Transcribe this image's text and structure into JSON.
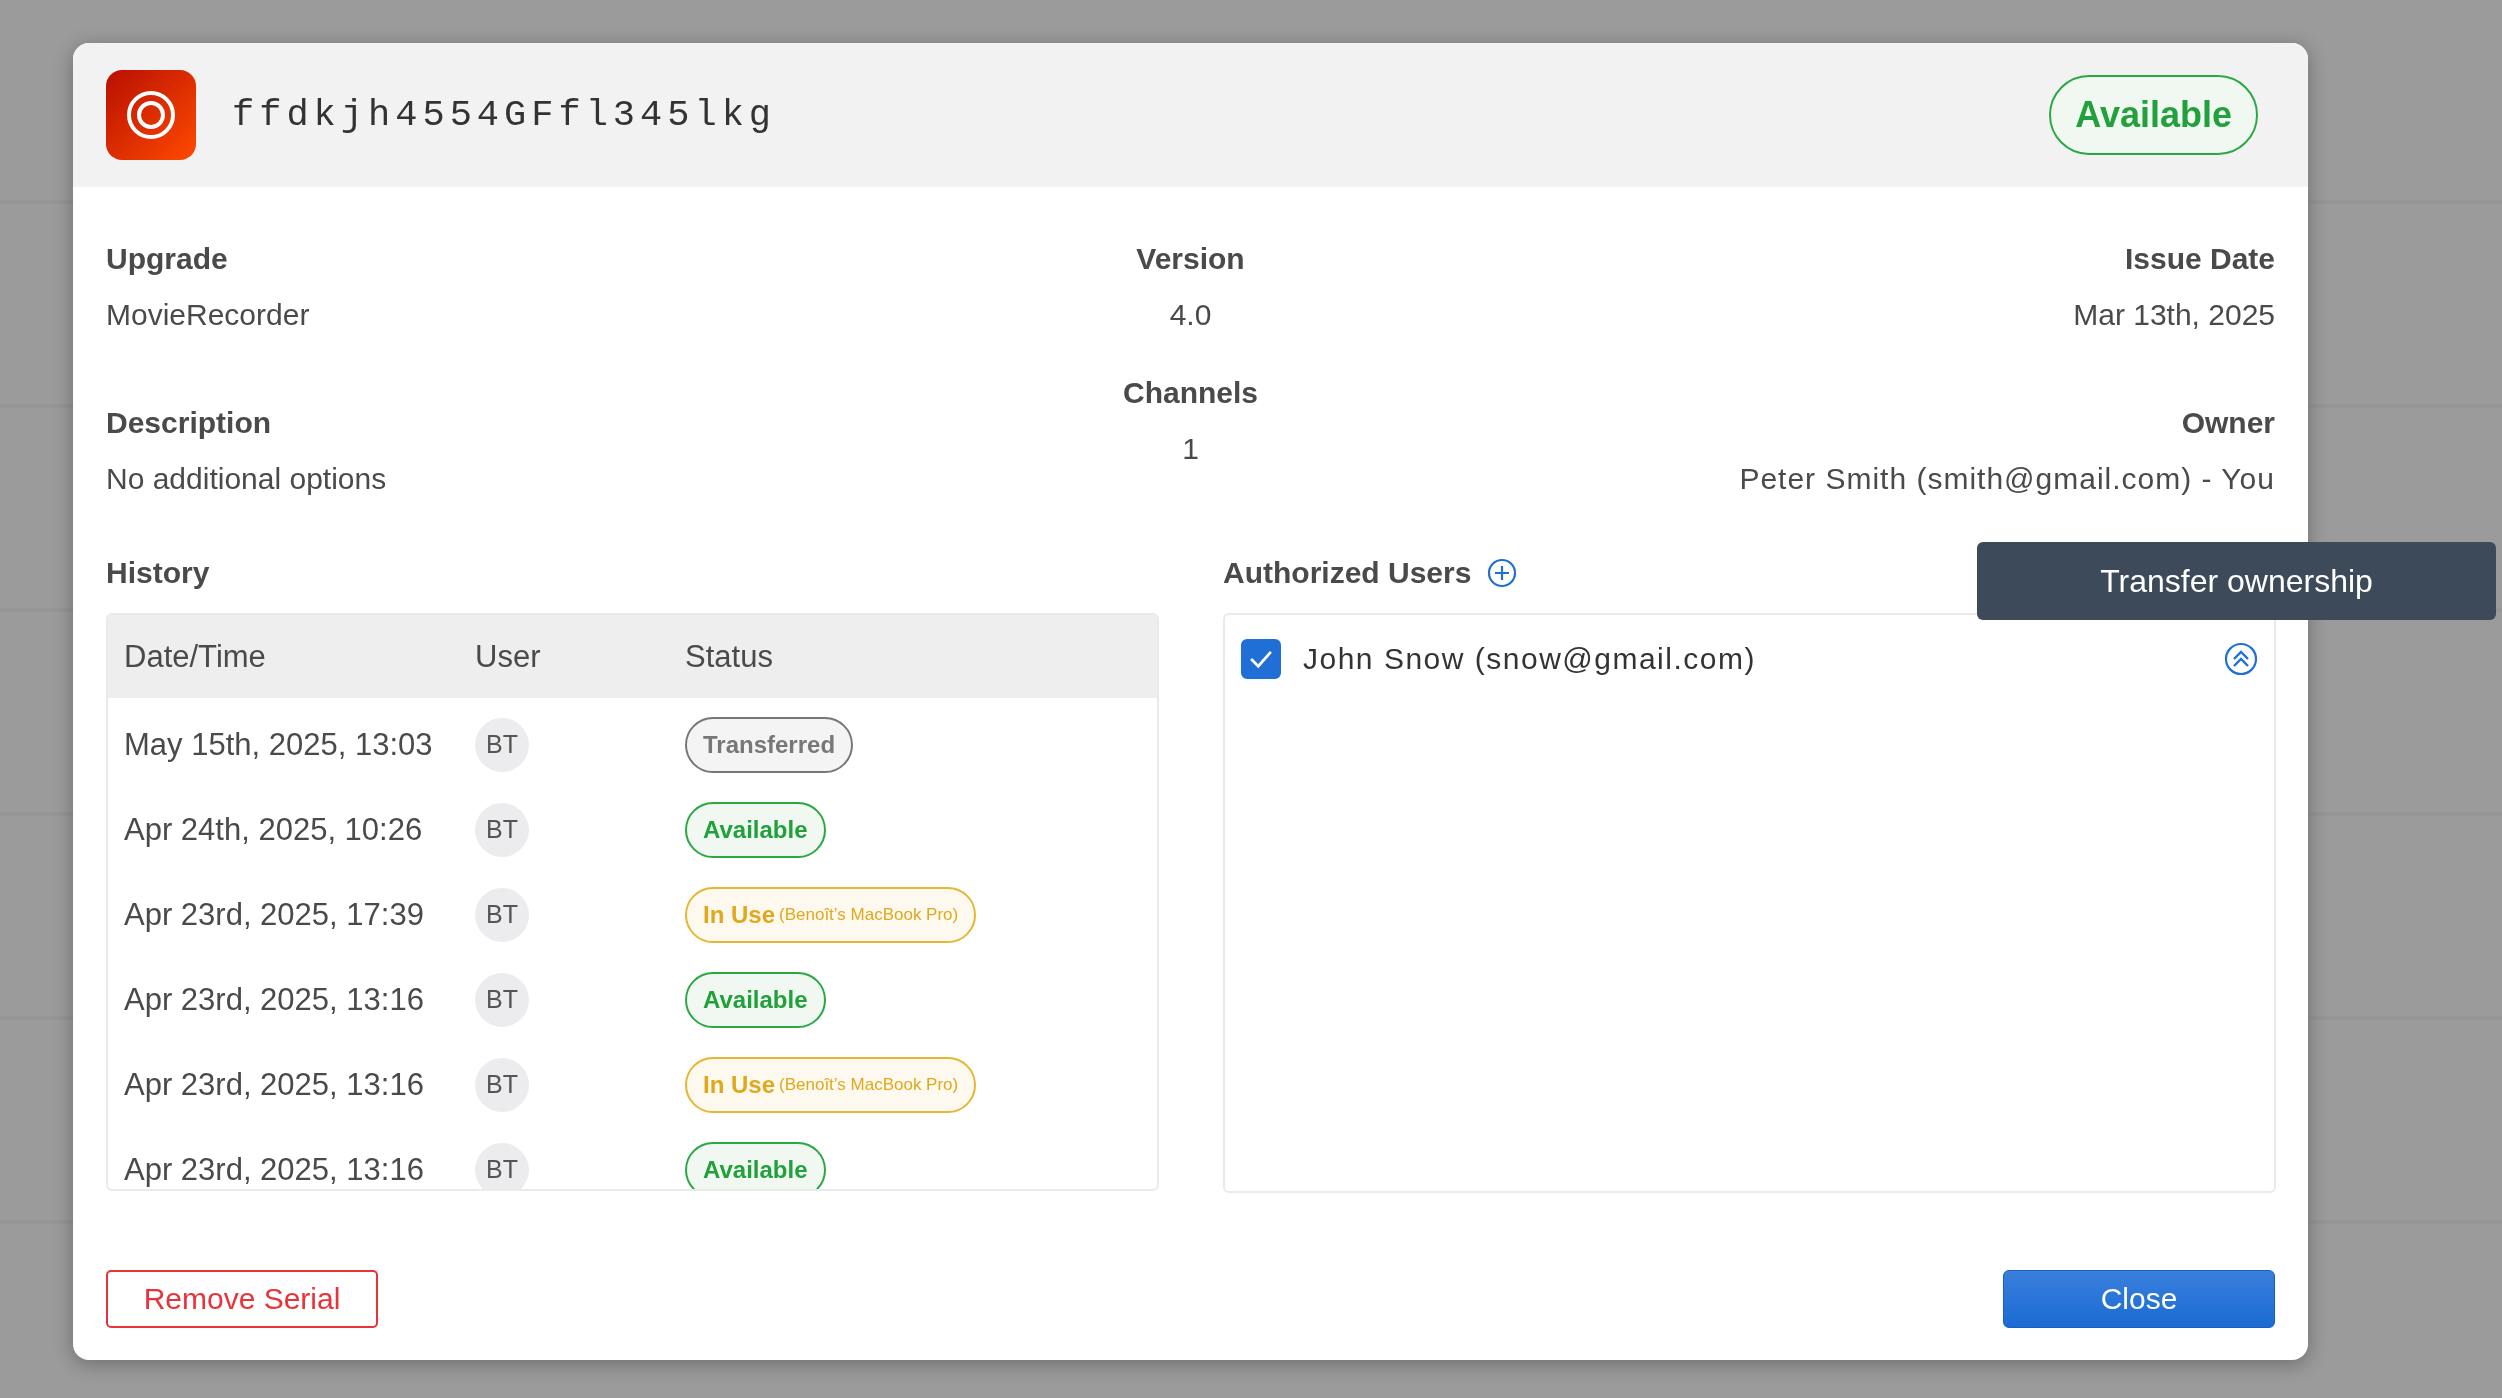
{
  "header": {
    "serial": "ffdkjh4554GFfl345lkg",
    "status": {
      "kind": "available",
      "label": "Available"
    }
  },
  "upgrade": {
    "label": "Upgrade",
    "value": "MovieRecorder"
  },
  "version": {
    "label": "Version",
    "value": "4.0"
  },
  "issue_date": {
    "label": "Issue Date",
    "value": "Mar 13th, 2025"
  },
  "description": {
    "label": "Description",
    "value": "No additional options"
  },
  "channels": {
    "label": "Channels",
    "value": "1"
  },
  "owner": {
    "label": "Owner",
    "value": "Peter Smith (smith@gmail.com) - You"
  },
  "history": {
    "title": "History",
    "columns": [
      "Date/Time",
      "User",
      "Status"
    ],
    "rows": [
      {
        "datetime": "May 15th, 2025, 13:03",
        "user": "BT",
        "status": {
          "kind": "transferred",
          "label": "Transferred"
        }
      },
      {
        "datetime": "Apr 24th, 2025, 10:26",
        "user": "BT",
        "status": {
          "kind": "available",
          "label": "Available"
        }
      },
      {
        "datetime": "Apr 23rd, 2025, 17:39",
        "user": "BT",
        "status": {
          "kind": "in_use",
          "label": "In Use",
          "detail": "(Benoît’s MacBook Pro)"
        }
      },
      {
        "datetime": "Apr 23rd, 2025, 13:16",
        "user": "BT",
        "status": {
          "kind": "available",
          "label": "Available"
        }
      },
      {
        "datetime": "Apr 23rd, 2025, 13:16",
        "user": "BT",
        "status": {
          "kind": "in_use",
          "label": "In Use",
          "detail": "(Benoît’s MacBook Pro)"
        }
      },
      {
        "datetime": "Apr 23rd, 2025, 13:16",
        "user": "BT",
        "status": {
          "kind": "available",
          "label": "Available"
        }
      }
    ]
  },
  "authorized_users": {
    "title": "Authorized Users",
    "users": [
      {
        "name": "John Snow (snow@gmail.com)",
        "checked": true
      }
    ],
    "tooltip": "Transfer ownership"
  },
  "buttons": {
    "remove": "Remove Serial",
    "close": "Close"
  }
}
